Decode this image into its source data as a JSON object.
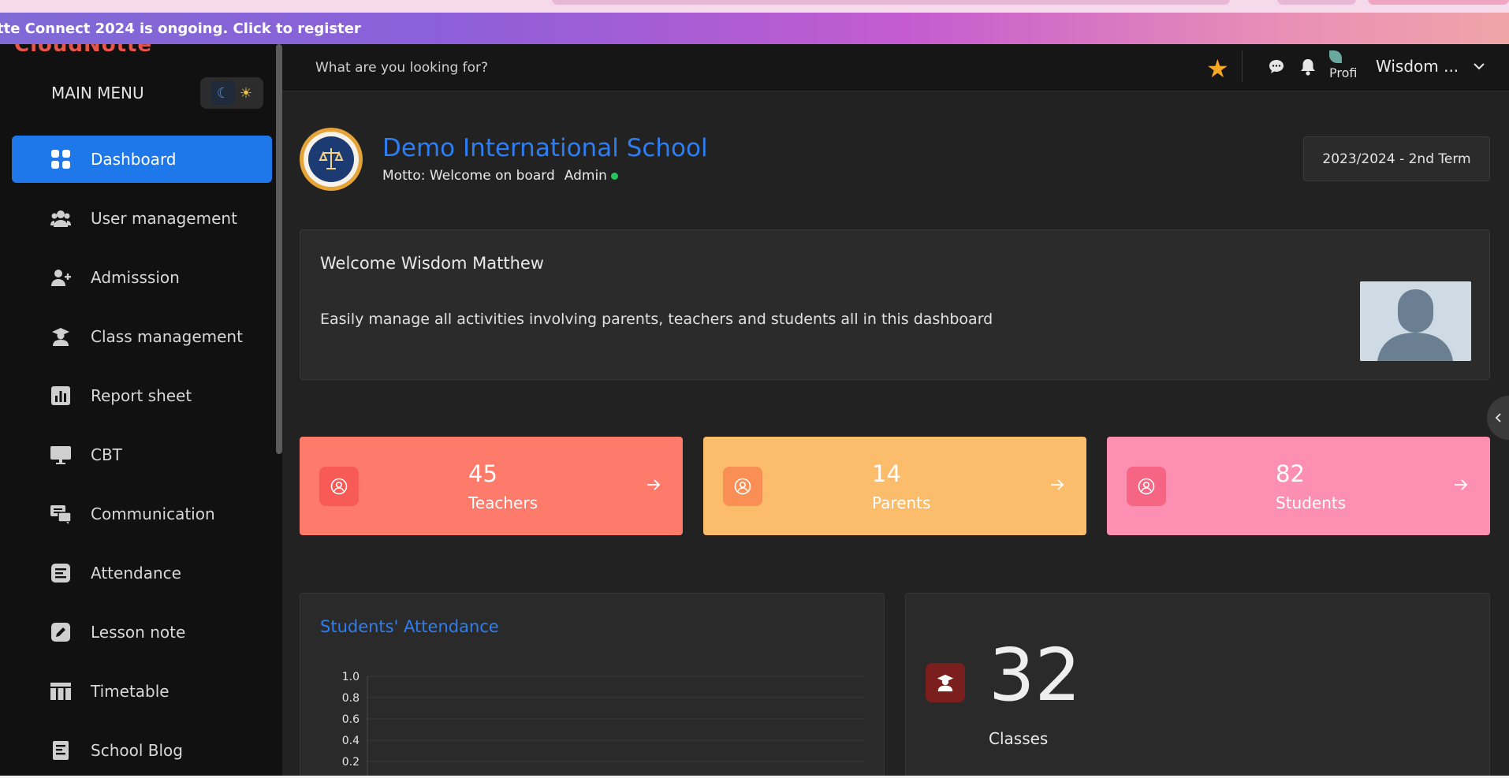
{
  "banner": {
    "text": "tte Connect 2024 is ongoing. Click to register"
  },
  "sidebar": {
    "logo_text": "CloudNotte",
    "menu_title": "MAIN MENU",
    "items": [
      {
        "label": "Dashboard",
        "icon": "grid-icon",
        "active": true
      },
      {
        "label": "User management",
        "icon": "users-icon"
      },
      {
        "label": "Admisssion",
        "icon": "add-user-icon"
      },
      {
        "label": "Class management",
        "icon": "graduate-icon"
      },
      {
        "label": "Report sheet",
        "icon": "bar-chart-icon"
      },
      {
        "label": "CBT",
        "icon": "monitor-icon"
      },
      {
        "label": "Communication",
        "icon": "chat-icon"
      },
      {
        "label": "Attendance",
        "icon": "list-icon"
      },
      {
        "label": "Lesson note",
        "icon": "edit-icon"
      },
      {
        "label": "Timetable",
        "icon": "table-icon"
      },
      {
        "label": "School Blog",
        "icon": "blog-icon"
      }
    ]
  },
  "header": {
    "search_placeholder": "What are you looking for?",
    "avatar_alt": "Profi",
    "username": "Wisdom ..."
  },
  "school": {
    "name": "Demo International School",
    "motto": "Motto: Welcome on board",
    "role": "Admin",
    "term": "2023/2024 - 2nd Term"
  },
  "welcome": {
    "title": "Welcome Wisdom Matthew",
    "text": "Easily manage all activities involving parents, teachers and students all in this dashboard"
  },
  "stats": [
    {
      "value": "45",
      "label": "Teachers",
      "color": "#fe7b6b",
      "icon_bg": "#f85a56"
    },
    {
      "value": "14",
      "label": "Parents",
      "color": "#fbbd6c",
      "icon_bg": "#f98f55"
    },
    {
      "value": "82",
      "label": "Students",
      "color": "#fd8fb3",
      "icon_bg": "#f76584"
    }
  ],
  "attendance": {
    "title": "Students' Attendance",
    "chart_data": {
      "type": "line",
      "y_ticks": [
        "1.0",
        "0.8",
        "0.6",
        "0.4",
        "0.2"
      ],
      "ylim": [
        0,
        1
      ],
      "grid": true
    }
  },
  "classes": {
    "value": "32",
    "label": "Classes"
  },
  "colors": {
    "accent": "#1f78ea",
    "online": "#22c55e",
    "star": "#f6a723"
  }
}
